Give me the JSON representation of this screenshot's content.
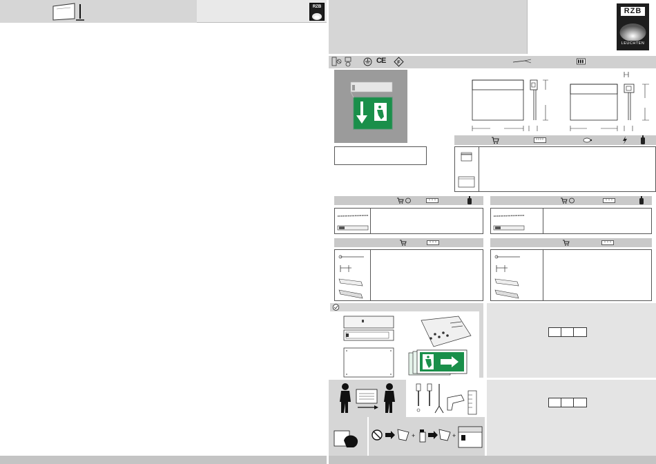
{
  "brand": {
    "logo_text": "RZB",
    "logo_subtext": "LEUCHTEN",
    "small_logo_text": "RZB"
  },
  "colors": {
    "header_gray": "#d6d6d6",
    "panel_gray": "#e9e9e9",
    "sign_green": "#1a8f4a",
    "sign_white": "#ffffff",
    "logo_dark": "#1d1d1d"
  },
  "icons": {
    "left_header": "monitor-stand-icon",
    "protection_class": "protection-class-icon",
    "ce_mark": "ce-mark-icon",
    "f_mark": "f-mark-icon",
    "earth": "earth-ground-icon",
    "cable": "cable-icon",
    "battery": "battery-icon",
    "cart": "cart-icon",
    "ruler": "ruler-icon",
    "bolt": "lightning-bolt-icon",
    "bottle": "bottle-icon"
  },
  "ce_label": "CE",
  "code_boxes_top": [
    "",
    "",
    ""
  ],
  "code_boxes_bottom": [
    "",
    "",
    ""
  ]
}
